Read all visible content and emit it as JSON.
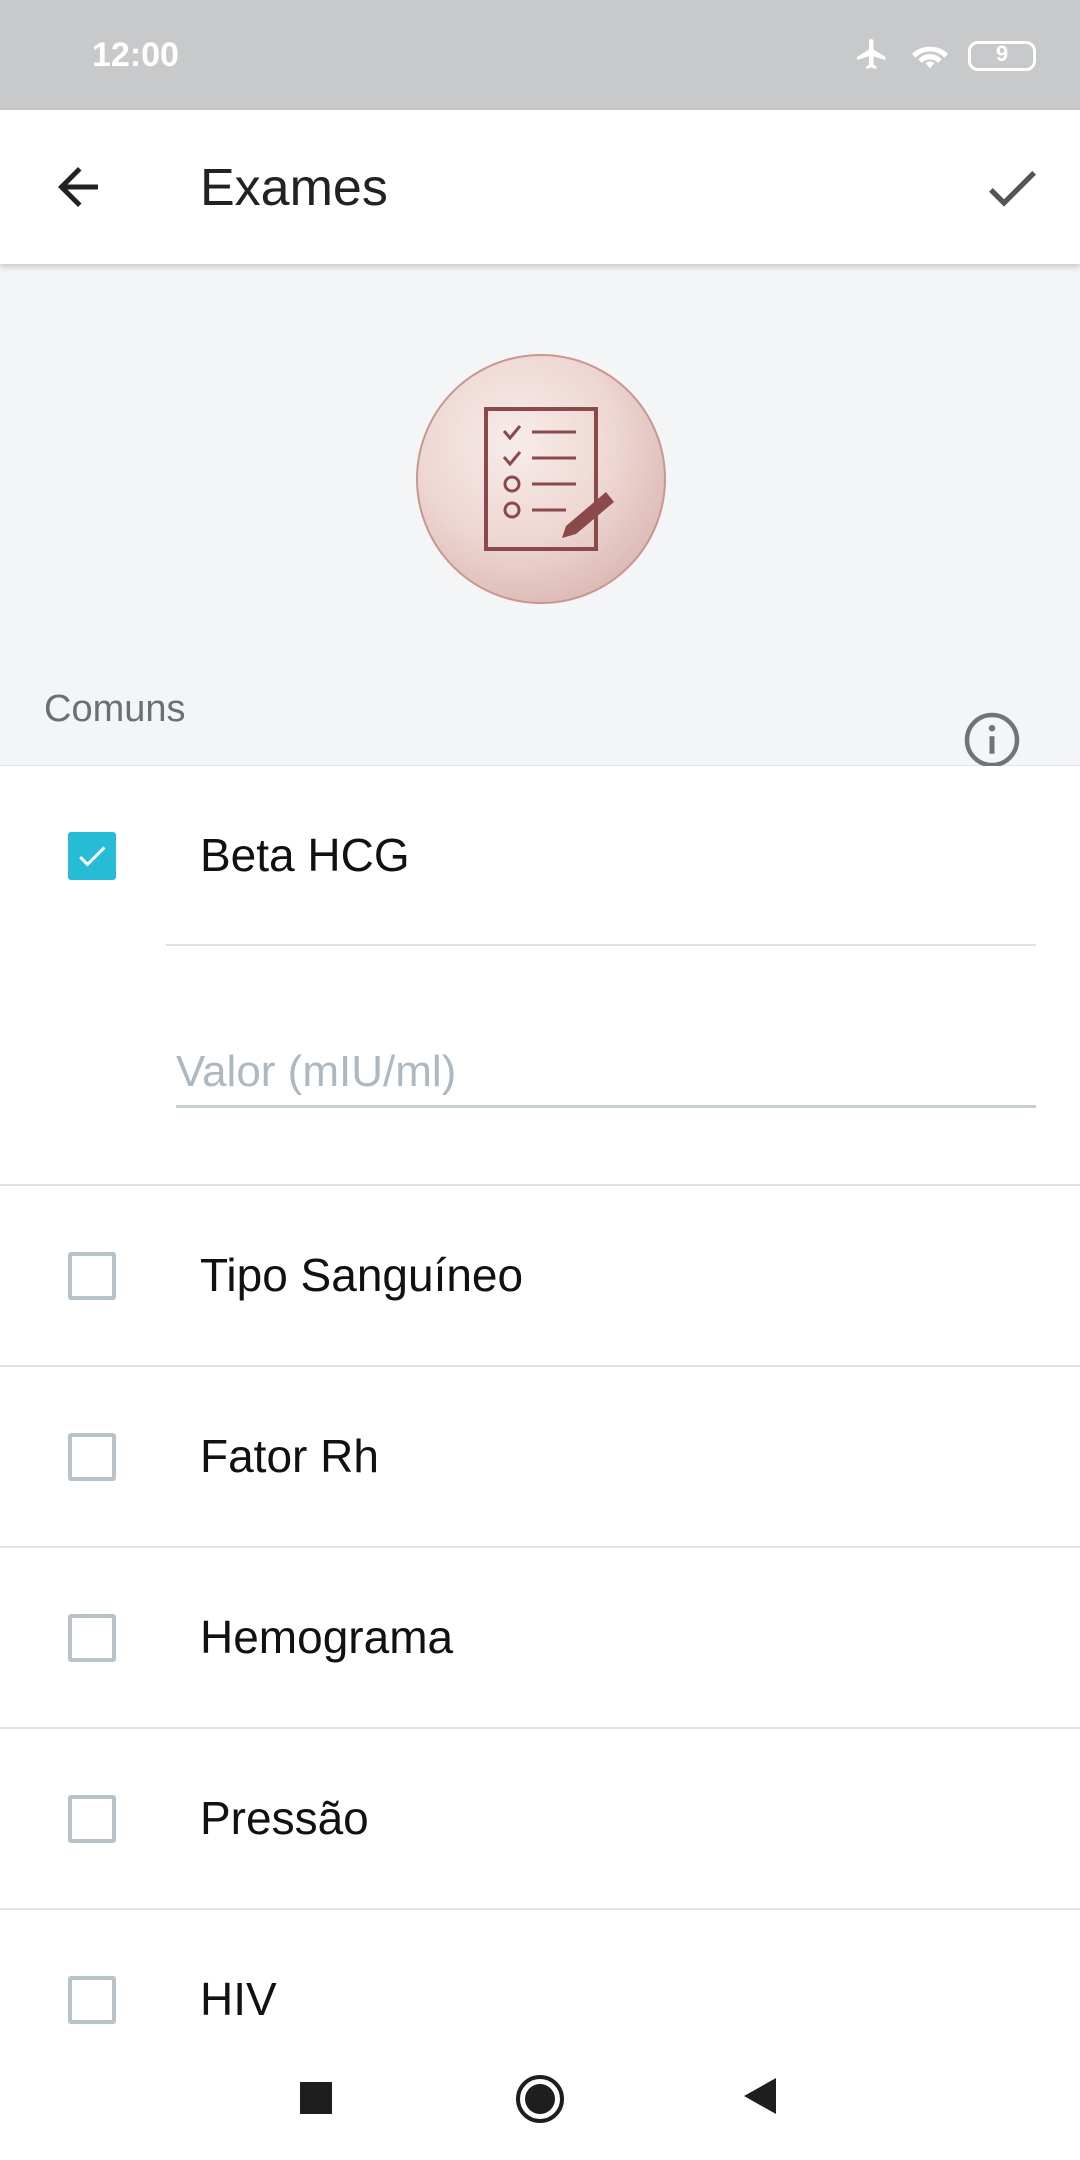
{
  "status_bar": {
    "time": "12:00",
    "battery": "9"
  },
  "app_bar": {
    "title": "Exames"
  },
  "header": {
    "logo": "checklist-pen-icon"
  },
  "section": {
    "label": "Comuns"
  },
  "exams": [
    {
      "label": "Beta HCG",
      "checked": true,
      "value_placeholder": "Valor (mIU/ml)",
      "value": ""
    },
    {
      "label": "Tipo Sanguíneo",
      "checked": false
    },
    {
      "label": "Fator Rh",
      "checked": false
    },
    {
      "label": "Hemograma",
      "checked": false
    },
    {
      "label": "Pressão",
      "checked": false
    },
    {
      "label": "HIV",
      "checked": false
    }
  ],
  "colors": {
    "accent": "#26bcd6",
    "logo_stroke": "#8a4a4a",
    "background": "#f3f5f7"
  }
}
